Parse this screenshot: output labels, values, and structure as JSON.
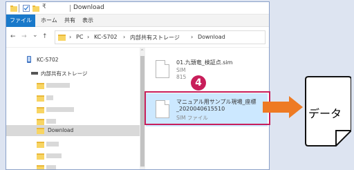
{
  "window": {
    "title": "Download",
    "ribbon_tabs": [
      "ファイル",
      "ホーム",
      "共有",
      "表示"
    ]
  },
  "address": {
    "nav_back": "←",
    "nav_forward": "→",
    "nav_dropdown": "⌄",
    "nav_up": "↑",
    "crumbs": [
      "›",
      "PC",
      "›",
      "KC-S702",
      "›",
      "内部共有ストレージ",
      "›",
      "Download"
    ]
  },
  "tree": {
    "device": "KC-S702",
    "storage": "内部共有ストレージ",
    "selected_folder": "Download"
  },
  "files": [
    {
      "name": "01.九頭竜_検証点.sim",
      "type": "SIM",
      "size": "815"
    },
    {
      "name_line1": "マニュアル用サンプル現場_座標",
      "name_line2": "_2020040615510",
      "type": "SIM ファイル"
    }
  ],
  "callout": {
    "step_number": "4",
    "label": "データ"
  },
  "colors": {
    "accent_red": "#c81e5a",
    "arrow_orange": "#ee7a23",
    "selection_blue": "#cce8ff",
    "ribbon_blue": "#1979ca"
  }
}
